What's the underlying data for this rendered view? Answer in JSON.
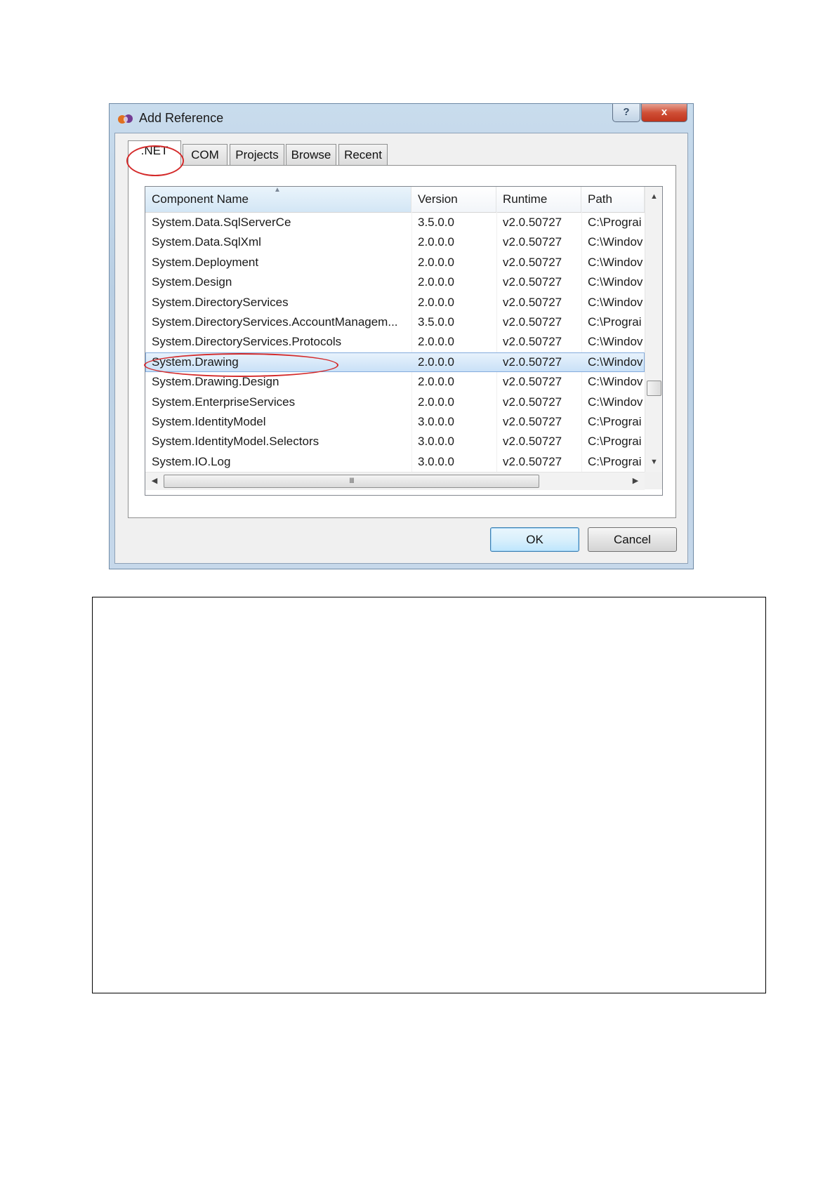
{
  "window": {
    "title": "Add Reference",
    "help_label": "?",
    "close_label": "x"
  },
  "tabs": [
    {
      "label": ".NET",
      "active": true
    },
    {
      "label": "COM",
      "active": false
    },
    {
      "label": "Projects",
      "active": false
    },
    {
      "label": "Browse",
      "active": false
    },
    {
      "label": "Recent",
      "active": false
    }
  ],
  "list": {
    "columns": [
      "Component Name",
      "Version",
      "Runtime",
      "Path"
    ],
    "sorted_column": "Component Name",
    "rows": [
      {
        "name": "System.Data.SqlServerCe",
        "version": "3.5.0.0",
        "runtime": "v2.0.50727",
        "path": "C:\\Prograi"
      },
      {
        "name": "System.Data.SqlXml",
        "version": "2.0.0.0",
        "runtime": "v2.0.50727",
        "path": "C:\\Windov"
      },
      {
        "name": "System.Deployment",
        "version": "2.0.0.0",
        "runtime": "v2.0.50727",
        "path": "C:\\Windov"
      },
      {
        "name": "System.Design",
        "version": "2.0.0.0",
        "runtime": "v2.0.50727",
        "path": "C:\\Windov"
      },
      {
        "name": "System.DirectoryServices",
        "version": "2.0.0.0",
        "runtime": "v2.0.50727",
        "path": "C:\\Windov"
      },
      {
        "name": "System.DirectoryServices.AccountManagem...",
        "version": "3.5.0.0",
        "runtime": "v2.0.50727",
        "path": "C:\\Prograi"
      },
      {
        "name": "System.DirectoryServices.Protocols",
        "version": "2.0.0.0",
        "runtime": "v2.0.50727",
        "path": "C:\\Windov"
      },
      {
        "name": "System.Drawing",
        "version": "2.0.0.0",
        "runtime": "v2.0.50727",
        "path": "C:\\Windov",
        "selected": true
      },
      {
        "name": "System.Drawing.Design",
        "version": "2.0.0.0",
        "runtime": "v2.0.50727",
        "path": "C:\\Windov"
      },
      {
        "name": "System.EnterpriseServices",
        "version": "2.0.0.0",
        "runtime": "v2.0.50727",
        "path": "C:\\Windov"
      },
      {
        "name": "System.IdentityModel",
        "version": "3.0.0.0",
        "runtime": "v2.0.50727",
        "path": "C:\\Prograi"
      },
      {
        "name": "System.IdentityModel.Selectors",
        "version": "3.0.0.0",
        "runtime": "v2.0.50727",
        "path": "C:\\Prograi"
      },
      {
        "name": "System.IO.Log",
        "version": "3.0.0.0",
        "runtime": "v2.0.50727",
        "path": "C:\\Prograi"
      }
    ],
    "hscroll_grip": "III"
  },
  "buttons": {
    "ok": "OK",
    "cancel": "Cancel"
  },
  "colors": {
    "annotation": "#d42a2a",
    "selection": "#c8e0f7"
  }
}
